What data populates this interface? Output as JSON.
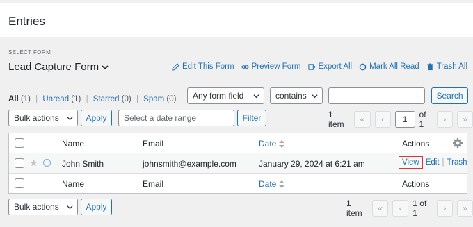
{
  "header": {
    "title": "Entries"
  },
  "form_selector": {
    "label": "SELECT FORM",
    "selected": "Lead Capture Form"
  },
  "top_actions": [
    {
      "label": "Edit This Form",
      "icon": "pencil-icon"
    },
    {
      "label": "Preview Form",
      "icon": "eye-icon"
    },
    {
      "label": "Export All",
      "icon": "export-icon"
    },
    {
      "label": "Mark All Read",
      "icon": "circle-icon"
    },
    {
      "label": "Trash All",
      "icon": "trash-icon"
    }
  ],
  "status_links": [
    {
      "label": "All",
      "count": "(1)"
    },
    {
      "label": "Unread",
      "count": "(1)"
    },
    {
      "label": "Starred",
      "count": "(0)"
    },
    {
      "label": "Spam",
      "count": "(0)"
    }
  ],
  "search": {
    "field": "Any form field",
    "operator": "contains",
    "value": "",
    "button": "Search"
  },
  "filters": {
    "bulk_actions": "Bulk actions",
    "apply": "Apply",
    "date_placeholder": "Select a date range",
    "filter": "Filter"
  },
  "pagination": {
    "items": "1 item",
    "current_page": "1",
    "of": "of 1",
    "of_bottom": "1 of 1"
  },
  "table": {
    "columns": {
      "name": "Name",
      "email": "Email",
      "date": "Date",
      "actions": "Actions"
    },
    "rows": [
      {
        "name": "John Smith",
        "email": "johnsmith@example.com",
        "date": "January 29, 2024 at 6:21 am",
        "view": "View",
        "edit": "Edit",
        "trash": "Trash"
      }
    ]
  },
  "bottom": {
    "bulk_actions": "Bulk actions",
    "apply": "Apply"
  },
  "colors": {
    "link": "#2271b1",
    "highlight_border": "#d63638",
    "bg": "#f0f0f1"
  }
}
